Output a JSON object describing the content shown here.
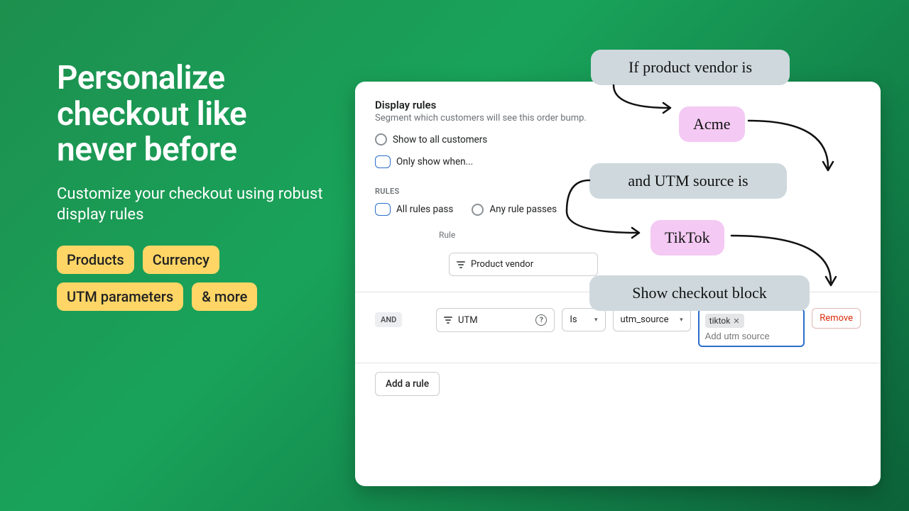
{
  "hero": {
    "headline": "Personalize checkout like never before",
    "sub": "Customize your checkout using robust display rules",
    "tags": [
      "Products",
      "Currency",
      "UTM parameters",
      "& more"
    ]
  },
  "settings": {
    "title": "Display rules",
    "desc": "Segment which customers will see this order bump.",
    "show_opts": {
      "all": "Show to all customers",
      "cond": "Only show when..."
    },
    "rules_label": "RULES",
    "match_opts": {
      "all": "All rules pass",
      "any": "Any rule passes"
    },
    "rule_hdr": "Rule",
    "rule1": {
      "field": "Product vendor"
    },
    "rule2": {
      "and": "AND",
      "field": "UTM",
      "op": "Is",
      "param": "utm_source",
      "chip": "tiktok",
      "placeholder": "Add utm source",
      "remove": "Remove"
    },
    "add_rule": "Add a rule"
  },
  "callouts": {
    "c1": "If product vendor is",
    "c2": "Acme",
    "c3": "and UTM source is",
    "c4": "TikTok",
    "c5": "Show checkout block"
  }
}
